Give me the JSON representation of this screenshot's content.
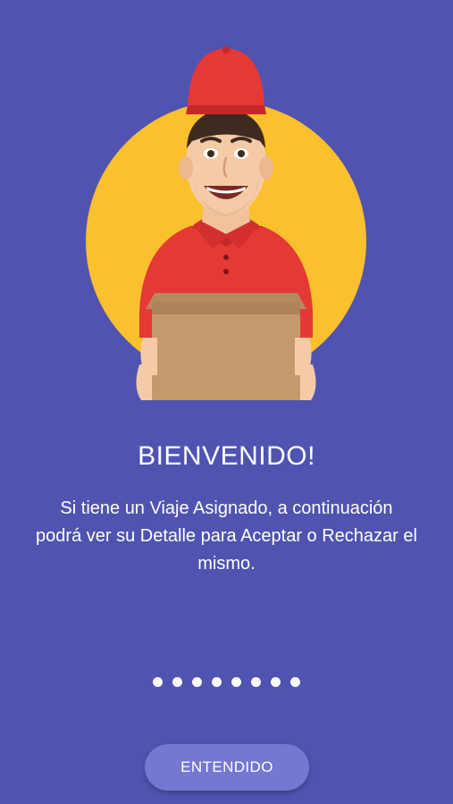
{
  "onboarding": {
    "title": "BIENVENIDO!",
    "description": "Si tiene un Viaje Asignado, a continuación podrá ver su Detalle para Aceptar o Rechazar el mismo.",
    "page_indicator": {
      "total_pages": 8,
      "current_page": 1
    },
    "illustration": "delivery-man-with-box-icon",
    "action_button_label": "ENTENDIDO"
  },
  "colors": {
    "background": "#5053B0",
    "illustration_circle": "#FBC02D",
    "button": "#7577D1",
    "text": "#FFFFFF"
  }
}
